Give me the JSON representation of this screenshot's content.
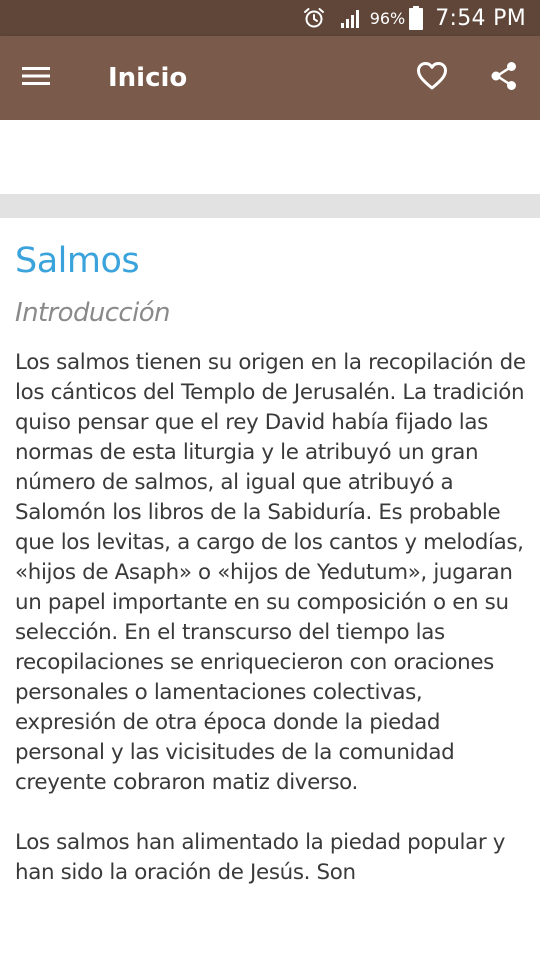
{
  "status_bar": {
    "battery_percent": "96%",
    "time": "7:54 PM",
    "icons": [
      "alarm-icon",
      "signal-icon",
      "battery-icon"
    ]
  },
  "app_bar": {
    "title": "Inicio",
    "icons": [
      "menu-icon",
      "heart-icon",
      "share-icon"
    ]
  },
  "colors": {
    "status_bar": "#5f4639",
    "app_bar": "#7a5a4a",
    "title_accent": "#3aa3db",
    "subtitle": "#8a8a8a",
    "body_text": "#3a3a3a"
  },
  "article": {
    "title": "Salmos",
    "subtitle": "Introducción",
    "paragraphs": [
      "Los salmos tienen su origen en la recopilación de los cánticos del Templo de Jerusalén. La tradición quiso pensar que el rey David había fijado las normas de esta liturgia y le atribuyó un gran número de salmos, al igual que atribuyó a Salomón los libros de la Sabiduría. Es probable que los levitas, a cargo de los cantos y melodías, «hijos de Asaph» o «hijos de Yedutum», jugaran un papel importante en su composición o en su selección. En el transcurso del tiempo las recopilaciones se enriquecieron con oraciones personales o lamentaciones colectivas, expresión de otra época donde la piedad personal y las vicisitudes de la comunidad creyente cobraron matiz diverso.",
      "Los salmos han alimentado la piedad popular y han sido la oración de Jesús. Son"
    ]
  }
}
